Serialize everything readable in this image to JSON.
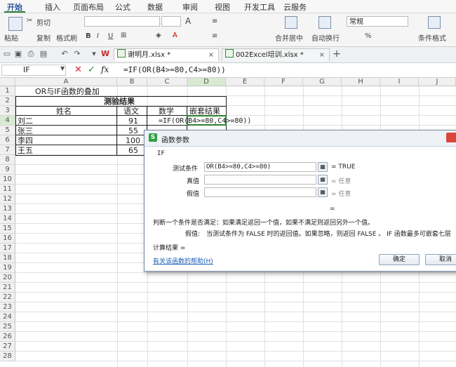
{
  "menu": [
    "开始",
    "插入",
    "页面布局",
    "公式",
    "数据",
    "审阅",
    "视图",
    "开发工具",
    "云服务"
  ],
  "ribbon": {
    "paste": "粘贴",
    "cut": "剪切",
    "copy": "复制",
    "format_painter": "格式刷",
    "font_size_a": "A",
    "merge": "合并居中",
    "wrap": "自动换行",
    "number_format": "常规",
    "percent": "%",
    "cond_format": "条件格式"
  },
  "tabs": [
    {
      "label": "谢明月.xlsx *"
    },
    {
      "label": "002Excel培训.xlsx *"
    }
  ],
  "formula_bar": {
    "name_box": "IF",
    "cancel": "✕",
    "ok": "✓",
    "fx": "fx",
    "formula": "=IF(OR(B4>=80,C4>=80))"
  },
  "columns": [
    "A",
    "B",
    "C",
    "D",
    "E",
    "F",
    "G",
    "H",
    "I",
    "J"
  ],
  "rows": [
    "1",
    "2",
    "3",
    "4",
    "5",
    "6",
    "7",
    "8",
    "9",
    "10",
    "11",
    "12",
    "13",
    "14",
    "15",
    "16",
    "17",
    "18",
    "19",
    "20",
    "21",
    "22",
    "23",
    "24",
    "25",
    "26",
    "27",
    "28"
  ],
  "sheet": {
    "a1": "OR与IF函数的叠加",
    "table_title": "测验结果",
    "h_name": "姓名",
    "h_chinese": "语文",
    "h_math": "数学",
    "h_nested": "嵌套结果",
    "r4_name": "刘二",
    "r4_chinese": "91",
    "r5_name": "张三",
    "r5_chinese": "55",
    "r6_name": "李四",
    "r6_chinese": "100",
    "r7_name": "王五",
    "r7_chinese": "65",
    "d4_formula": "=IF(OR(B4>=80,C4>=80))"
  },
  "dialog": {
    "title": "函数参数",
    "func": "IF",
    "arg1_label": "测试条件",
    "arg1_value": "OR(B4>=80,C4>=80)",
    "arg1_result": "= TRUE",
    "arg2_label": "真值",
    "arg2_result": "= 任意",
    "arg3_label": "假值",
    "arg3_result": "= 任意",
    "total_eq": "=",
    "desc": "判断一个条件是否满足：如果满足返回一个值，如果不满足则返回另外一个值。",
    "desc_label": "假值:",
    "desc_detail": "当测试条件为 FALSE 时的返回值。如果忽略，则返回 FALSE 。 IF 函数最多可嵌套七层",
    "result_label": "计算结果 =",
    "help_link": "有关该函数的帮助(H)",
    "ok": "确定",
    "cancel": "取消"
  },
  "colors": {
    "accent": "#2e7d32",
    "selected_col": "#d9ead3",
    "link": "#1a5fb4"
  }
}
